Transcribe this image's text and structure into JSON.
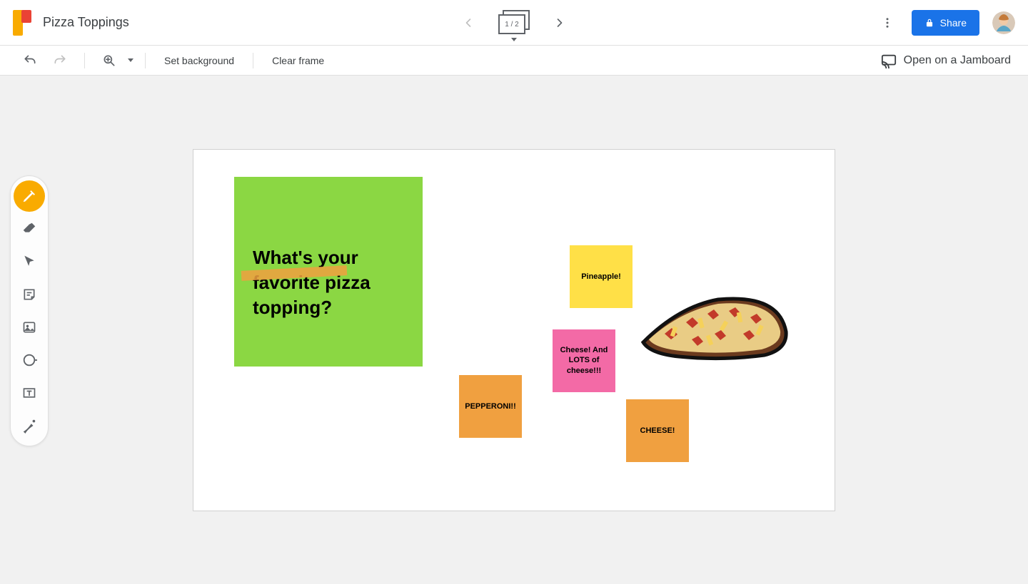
{
  "header": {
    "doc_title": "Pizza Toppings",
    "frame_counter": "1 / 2",
    "share_label": "Share"
  },
  "toolbar": {
    "set_background": "Set background",
    "clear_frame": "Clear frame",
    "open_jamboard": "Open on a Jamboard"
  },
  "tools": [
    {
      "name": "pen-tool-icon",
      "active": true
    },
    {
      "name": "eraser-tool-icon",
      "active": false
    },
    {
      "name": "select-tool-icon",
      "active": false
    },
    {
      "name": "sticky-note-tool-icon",
      "active": false
    },
    {
      "name": "image-tool-icon",
      "active": false
    },
    {
      "name": "shape-tool-icon",
      "active": false
    },
    {
      "name": "textbox-tool-icon",
      "active": false
    },
    {
      "name": "laser-tool-icon",
      "active": false
    }
  ],
  "canvas": {
    "big_note": "What's your favorite pizza topping?",
    "notes": {
      "pineapple": "Pineapple!",
      "cheese_lots": "Cheese! And LOTS of cheese!!!",
      "pepperoni": "PEPPERONI!!",
      "cheese": "CHEESE!"
    }
  }
}
